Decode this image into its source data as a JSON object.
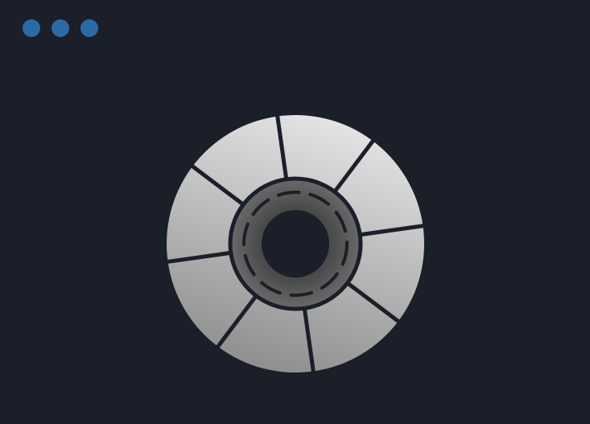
{
  "window": {
    "controls": [
      {
        "name": "close",
        "color": "#2c6aa6"
      },
      {
        "name": "minimize",
        "color": "#2c6aa6"
      },
      {
        "name": "maximize",
        "color": "#2c6aa6"
      }
    ],
    "background": "#1a1f29"
  },
  "wheel": {
    "segment_count": 8,
    "colors": {
      "segment_light": "#e4e4e4",
      "segment_dark": "#8c8c8c",
      "divider": "#1a1f29",
      "hub_light": "#6a6a6a",
      "hub_dark": "#4a4a4a",
      "hole": "#1a1f29"
    },
    "icon": "loading-spinner-wheel-icon"
  }
}
